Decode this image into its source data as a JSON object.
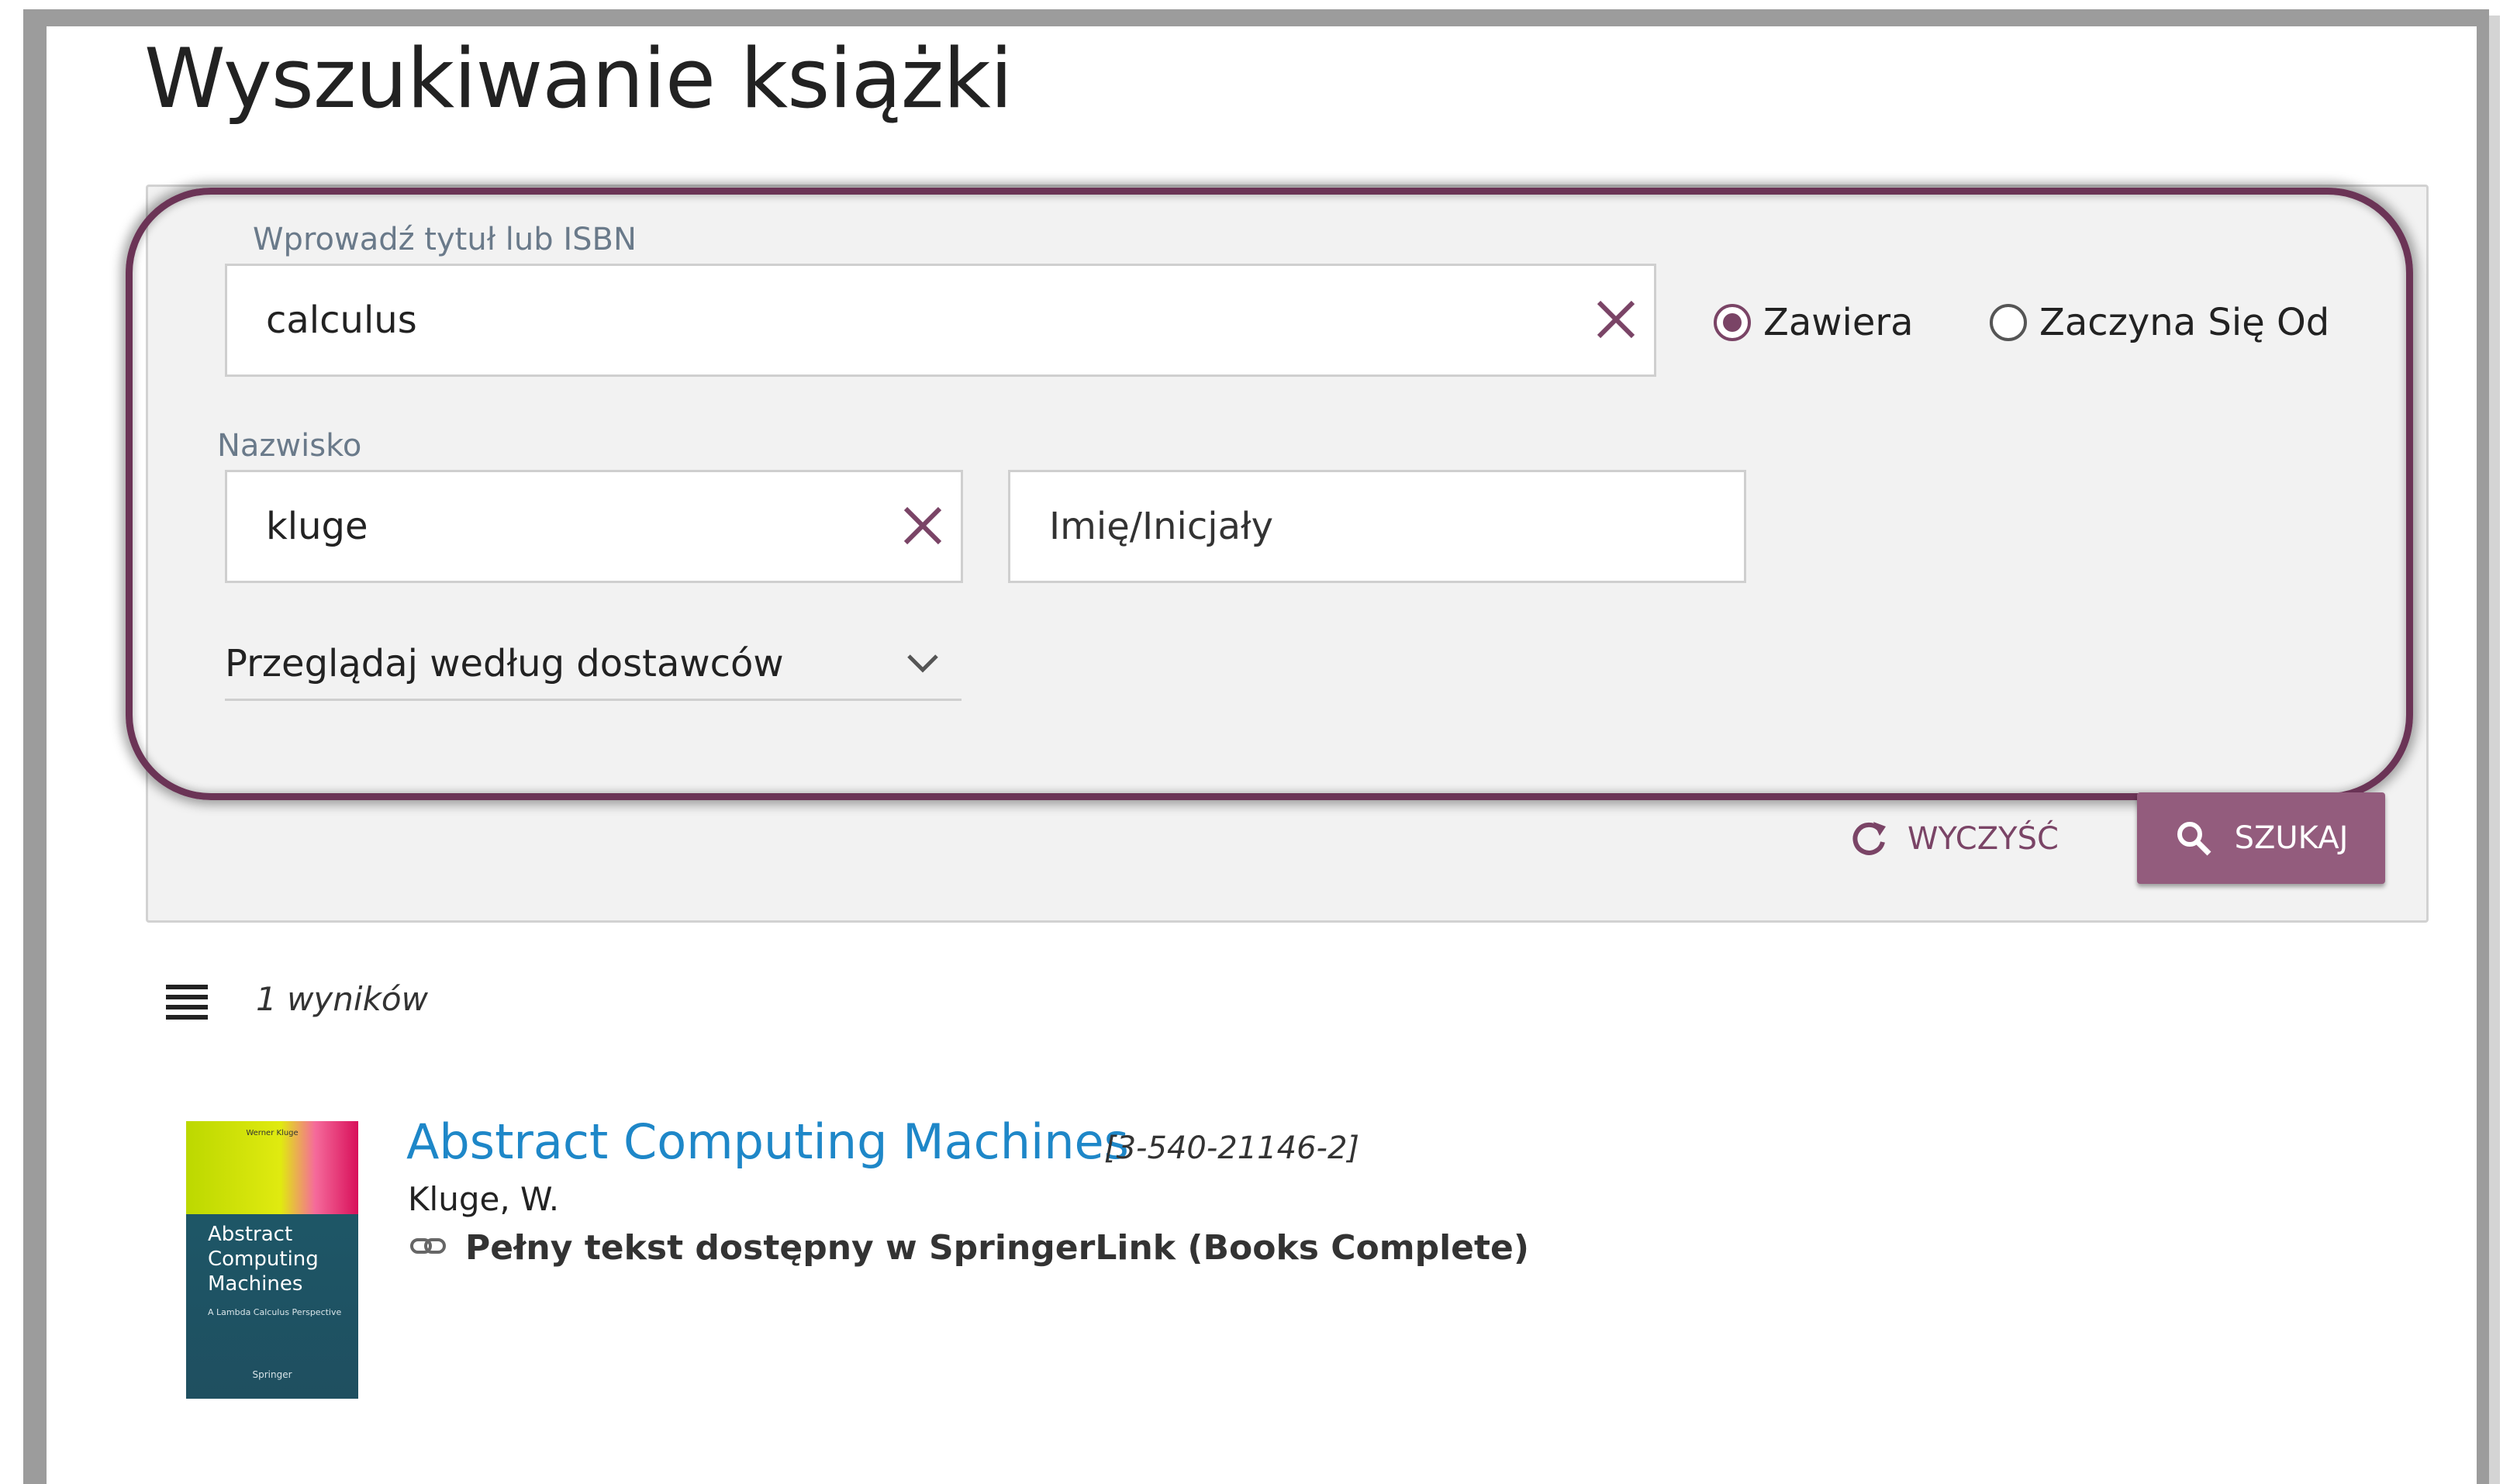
{
  "page": {
    "title": "Wyszukiwanie książki"
  },
  "search": {
    "title_label": "Wprowadź tytuł lub ISBN",
    "title_value": "calculus",
    "match_options": [
      {
        "label": "Zawiera",
        "checked": true
      },
      {
        "label": "Zaczyna Się Od",
        "checked": false
      }
    ],
    "surname_label": "Nazwisko",
    "surname_value": "kluge",
    "firstname_placeholder": "Imię/Inicjały",
    "provider_dropdown_label": "Przeglądaj według dostawców",
    "clear_label": "WYCZYŚĆ",
    "search_label": "SZUKAJ"
  },
  "results": {
    "count_text": "1 wyników",
    "items": [
      {
        "title": "Abstract Computing Machines",
        "isbn": "[3-540-21146-2]",
        "author": "Kluge, W.",
        "fulltext": "Pełny tekst dostępny w SpringerLink (Books Complete)",
        "cover": {
          "author": "Werner Kluge",
          "title_lines": [
            "Abstract",
            "Computing",
            "Machines"
          ],
          "subtitle": "A Lambda Calculus Perspective",
          "publisher": "Springer"
        }
      }
    ]
  },
  "colors": {
    "accent": "#935c7d",
    "ring": "#6b3456",
    "link": "#1e87c8"
  }
}
